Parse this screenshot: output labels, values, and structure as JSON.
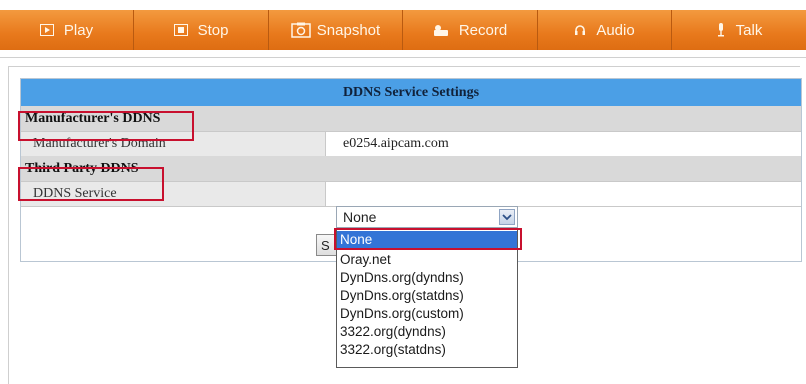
{
  "toolbar": {
    "play_label": "Play",
    "stop_label": "Stop",
    "snapshot_label": "Snapshot",
    "record_label": "Record",
    "audio_label": "Audio",
    "talk_label": "Talk"
  },
  "ddns": {
    "header": "DDNS Service Settings",
    "manufacturer_section": "Manufacturer's DDNS",
    "manufacturer_domain_label": "Manufacturer's Domain",
    "manufacturer_domain_value": "e0254.aipcam.com",
    "third_party_section": "Third Party DDNS",
    "service_label": "DDNS Service",
    "service_selected": "None",
    "save_button_visible": "S"
  },
  "dropdown": {
    "options": [
      "None",
      "Oray.net",
      "DynDns.org(dyndns)",
      "DynDns.org(statdns)",
      "DynDns.org(custom)",
      "3322.org(dyndns)",
      "3322.org(statdns)"
    ],
    "selected_index": 0
  },
  "colors": {
    "toolbar_orange": "#e8791c",
    "header_blue": "#4b9fe6",
    "highlight_red": "#c8102e",
    "selection_blue": "#3374d6"
  }
}
